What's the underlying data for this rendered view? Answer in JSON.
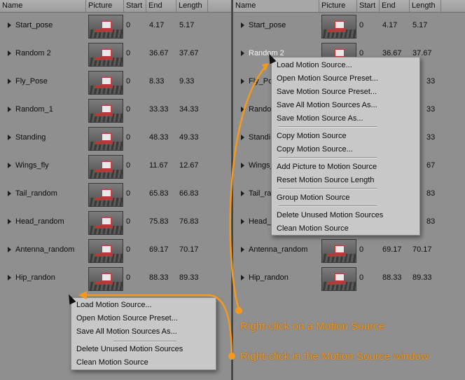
{
  "columns": [
    "Name",
    "Picture",
    "Start",
    "End",
    "Length"
  ],
  "sources": [
    {
      "name": "Start_pose",
      "start": "0",
      "end": "4.17",
      "length": "5.17"
    },
    {
      "name": "Random 2",
      "start": "0",
      "end": "36.67",
      "length": "37.67"
    },
    {
      "name": "Fly_Pose",
      "start": "0",
      "end": "8.33",
      "length": "9.33"
    },
    {
      "name": "Random_1",
      "start": "0",
      "end": "33.33",
      "length": "34.33"
    },
    {
      "name": "Standing",
      "start": "0",
      "end": "48.33",
      "length": "49.33"
    },
    {
      "name": "Wings_fly",
      "start": "0",
      "end": "11.67",
      "length": "12.67"
    },
    {
      "name": "Tail_random",
      "start": "0",
      "end": "65.83",
      "length": "66.83"
    },
    {
      "name": "Head_random",
      "start": "0",
      "end": "75.83",
      "length": "76.83"
    },
    {
      "name": "Antenna_random",
      "start": "0",
      "end": "69.17",
      "length": "70.17"
    },
    {
      "name": "Hip_randon",
      "start": "0",
      "end": "88.33",
      "length": "89.33"
    }
  ],
  "right_visible": {
    "row1": {
      "name": "Fly_Pos",
      "length": "33"
    },
    "row3": {
      "name": "Random",
      "length": "33"
    },
    "row4": {
      "name": "Standin",
      "length": "33"
    },
    "row5": {
      "name": "Wings_",
      "length": "67"
    },
    "row6": {
      "name": "Tail_ra",
      "length": "83"
    },
    "row7": {
      "name": "Head_",
      "length": "83"
    }
  },
  "source_menu": {
    "items": [
      "Load Motion Source...",
      "Open Motion Source Preset...",
      "Save Motion Source Preset...",
      "Save All Motion Sources As...",
      "Save Motion Source As...",
      "Copy Motion Source",
      "Copy Motion Source...",
      "Add Picture to Motion Source",
      "Reset Motion Source Length",
      "Group Motion Source",
      "Delete Unused Motion Sources",
      "Clean Motion Source"
    ]
  },
  "window_menu": {
    "items": [
      "Load Motion Source...",
      "Open Motion Source Preset...",
      "Save All Motion Sources As...",
      "Delete Unused Motion Sources",
      "Clean Motion Source"
    ]
  },
  "annotations": {
    "source": "Right-click on a Motion Source",
    "window": "Right-click in the Motion Source window"
  },
  "colors": {
    "panel": "#8f8f8f",
    "menu": "#c8c8c8",
    "accent": "#f39a1c"
  }
}
